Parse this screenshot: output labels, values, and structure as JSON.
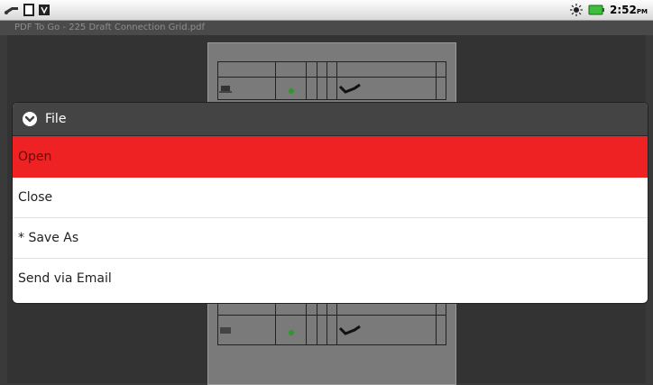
{
  "status_bar": {
    "icons_left": [
      "usb-icon",
      "sd-card-icon",
      "debug-icon"
    ],
    "icons_right": [
      "brightness-icon",
      "battery-icon"
    ],
    "time": "2:52",
    "ampm": "PM"
  },
  "app": {
    "title": "PDF To Go - 225 Draft Connection Grid.pdf"
  },
  "dialog": {
    "title": "File",
    "icon": "chevron-down-circle-icon",
    "items": [
      {
        "label": "Open",
        "selected": true
      },
      {
        "label": "Close",
        "selected": false
      },
      {
        "label": "* Save As",
        "selected": false
      },
      {
        "label": "Send via Email",
        "selected": false
      }
    ],
    "selected_color": "#ee2222"
  }
}
